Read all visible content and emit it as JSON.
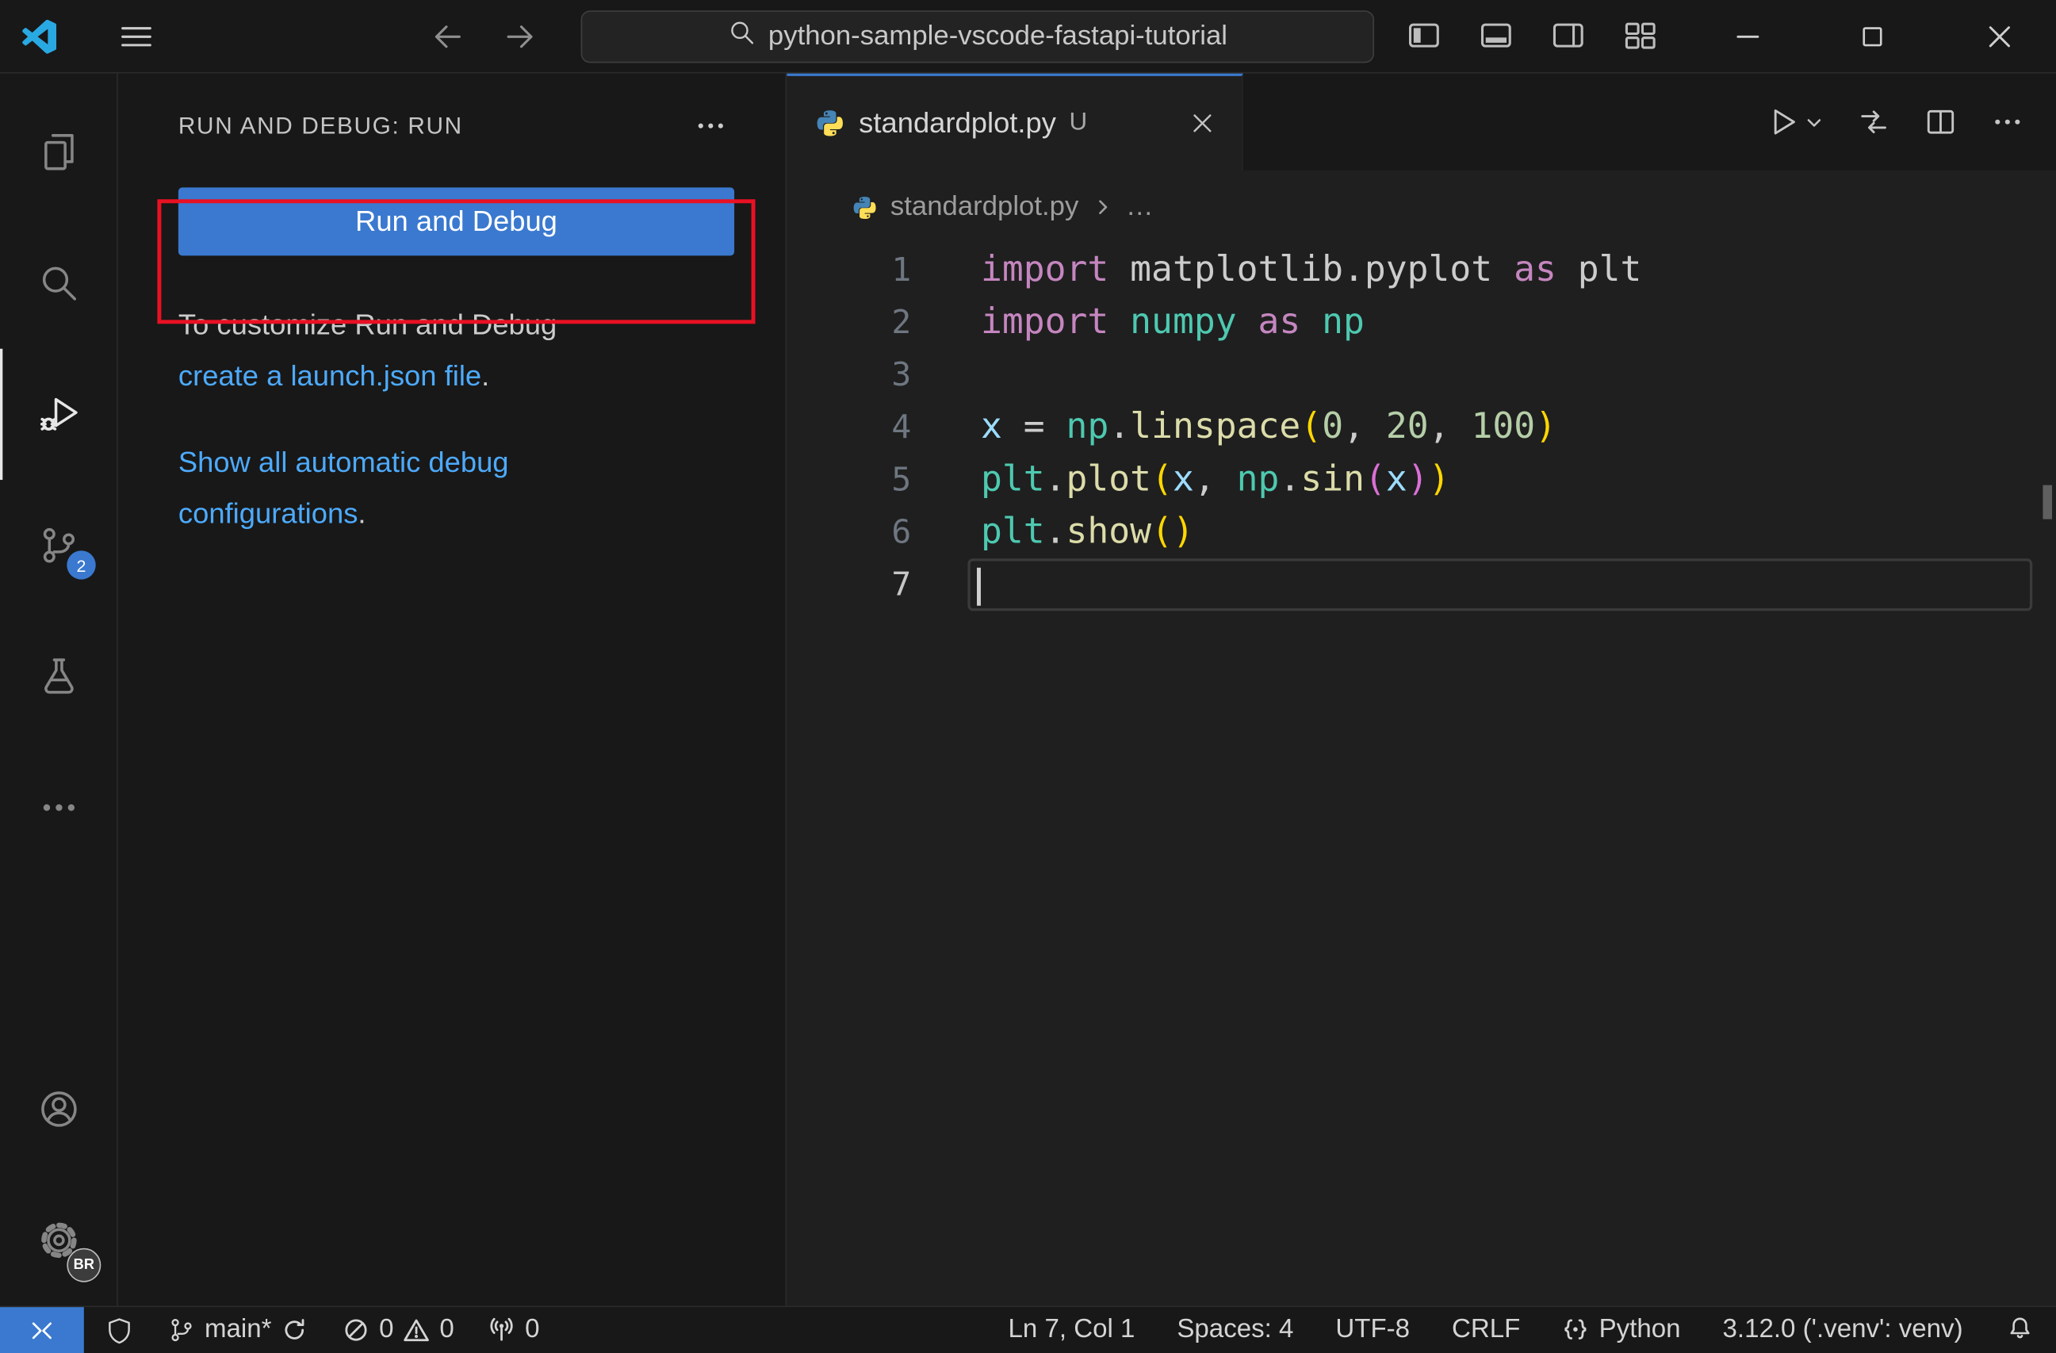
{
  "colors": {
    "accent": "#3a79cf",
    "link": "#4daafc",
    "annotation_red": "#e81123",
    "logo_blue": "#29a9e2"
  },
  "title_bar": {
    "search_value": "python-sample-vscode-fastapi-tutorial"
  },
  "activity_bar": {
    "source_control_badge": "2",
    "profile_badge": "BR"
  },
  "sidebar": {
    "header": "RUN AND DEBUG: RUN",
    "run_button_label": "Run and Debug",
    "customize_text": "To customize Run and Debug",
    "customize_link": "create a launch.json file",
    "customize_suffix": ".",
    "show_all_link_line1": "Show all automatic debug",
    "show_all_link_line2": "configurations",
    "show_all_suffix": "."
  },
  "editor": {
    "tab": {
      "label": "standardplot.py",
      "git_status": "U"
    },
    "breadcrumb": {
      "file": "standardplot.py",
      "symbol": "…"
    },
    "code": {
      "current_line": 7,
      "palette": {
        "kw": "#C586C0",
        "pl": "#CCCCCC",
        "mod": "#4EC9B0",
        "fn": "#DCDCAA",
        "var": "#9CDCFE",
        "num": "#B5CEA8",
        "b1": "#FFD700",
        "b2": "#DA70D6"
      },
      "lines": [
        {
          "n": 1,
          "tokens": [
            [
              "import",
              "kw"
            ],
            [
              " ",
              "pl"
            ],
            [
              "matplotlib.pyplot",
              "pl"
            ],
            [
              " ",
              "pl"
            ],
            [
              "as",
              "kw"
            ],
            [
              " ",
              "pl"
            ],
            [
              "plt",
              "pl"
            ]
          ]
        },
        {
          "n": 2,
          "tokens": [
            [
              "import",
              "kw"
            ],
            [
              " ",
              "pl"
            ],
            [
              "numpy",
              "mod"
            ],
            [
              " ",
              "pl"
            ],
            [
              "as",
              "kw"
            ],
            [
              " ",
              "pl"
            ],
            [
              "np",
              "mod"
            ]
          ]
        },
        {
          "n": 3,
          "tokens": []
        },
        {
          "n": 4,
          "tokens": [
            [
              "x",
              "var"
            ],
            [
              " ",
              "pl"
            ],
            [
              "=",
              "pl"
            ],
            [
              " ",
              "pl"
            ],
            [
              "np",
              "mod"
            ],
            [
              ".",
              "pl"
            ],
            [
              "linspace",
              "fn"
            ],
            [
              "(",
              "b1"
            ],
            [
              "0",
              "num"
            ],
            [
              ",",
              "pl"
            ],
            [
              " ",
              "pl"
            ],
            [
              "20",
              "num"
            ],
            [
              ",",
              "pl"
            ],
            [
              " ",
              "pl"
            ],
            [
              "100",
              "num"
            ],
            [
              ")",
              "b1"
            ]
          ]
        },
        {
          "n": 5,
          "tokens": [
            [
              "plt",
              "mod"
            ],
            [
              ".",
              "pl"
            ],
            [
              "plot",
              "fn"
            ],
            [
              "(",
              "b1"
            ],
            [
              "x",
              "var"
            ],
            [
              ",",
              "pl"
            ],
            [
              " ",
              "pl"
            ],
            [
              "np",
              "mod"
            ],
            [
              ".",
              "pl"
            ],
            [
              "sin",
              "fn"
            ],
            [
              "(",
              "b2"
            ],
            [
              "x",
              "var"
            ],
            [
              ")",
              "b2"
            ],
            [
              ")",
              "b1"
            ]
          ]
        },
        {
          "n": 6,
          "tokens": [
            [
              "plt",
              "mod"
            ],
            [
              ".",
              "pl"
            ],
            [
              "show",
              "fn"
            ],
            [
              "(",
              "b1"
            ],
            [
              ")",
              "b1"
            ]
          ]
        },
        {
          "n": 7,
          "tokens": []
        }
      ]
    }
  },
  "status_bar": {
    "branch": "main*",
    "errors": "0",
    "warnings": "0",
    "ports": "0",
    "line_col": "Ln 7, Col 1",
    "indent": "Spaces: 4",
    "encoding": "UTF-8",
    "eol": "CRLF",
    "language": "Python",
    "interpreter": "3.12.0 ('.venv': venv)"
  }
}
